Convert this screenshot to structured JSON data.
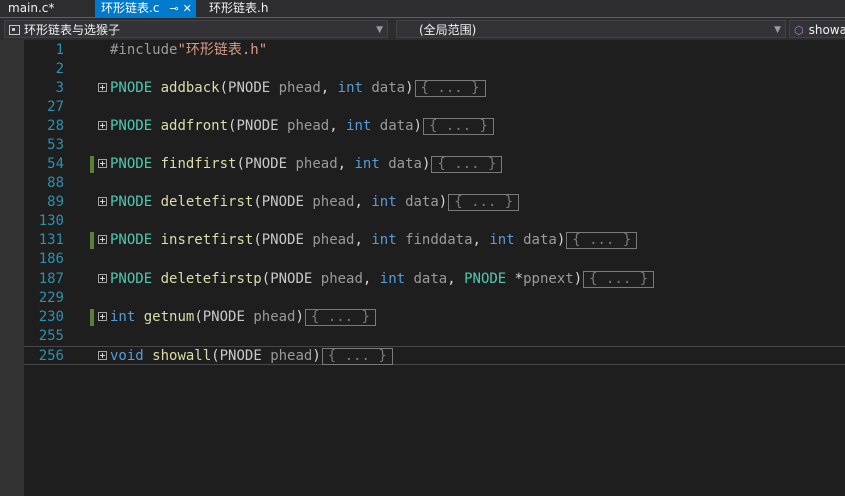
{
  "tabs": [
    {
      "label": "main.c*",
      "active": false
    },
    {
      "label": "环形链表.c",
      "active": true,
      "pin_icon": "pin-icon",
      "close_icon": "close-icon"
    },
    {
      "label": "环形链表.h",
      "active": false
    }
  ],
  "navbar": {
    "project": "环形链表与选猴子",
    "scope": "(全局范围)",
    "member": "showa"
  },
  "colors": {
    "accent": "#007acc",
    "type": "#4ec9b0",
    "function": "#dcdcaa",
    "keyword": "#569cd6",
    "param": "#9a9a9a",
    "line_number": "#2b91af",
    "changed_bar": "#5b7e3a"
  },
  "collapsed_text": "{ ... }",
  "code": {
    "l1": {
      "num": "1",
      "directive": "#include",
      "file": "\"环形链表.h\""
    },
    "l2": {
      "num": "2"
    },
    "l3": {
      "num": "3",
      "ret": "PNODE",
      "name": "addback",
      "open": "(",
      "p1t": "PNODE",
      "p1": " phead",
      "c1": ", ",
      "p2t": "int",
      "p2": " data",
      "close": ")"
    },
    "l27": {
      "num": "27"
    },
    "l28": {
      "num": "28",
      "ret": "PNODE",
      "name": "addfront",
      "open": "(",
      "p1t": "PNODE",
      "p1": " phead",
      "c1": ", ",
      "p2t": "int",
      "p2": " data",
      "close": ")"
    },
    "l53": {
      "num": "53"
    },
    "l54": {
      "num": "54",
      "ret": "PNODE",
      "name": "findfirst",
      "open": "(",
      "p1t": "PNODE",
      "p1": " phead",
      "c1": ", ",
      "p2t": "int",
      "p2": " data",
      "close": ")"
    },
    "l88": {
      "num": "88"
    },
    "l89": {
      "num": "89",
      "ret": "PNODE",
      "name": "deletefirst",
      "open": "(",
      "p1t": "PNODE",
      "p1": " phead",
      "c1": ", ",
      "p2t": "int",
      "p2": " data",
      "close": ")"
    },
    "l130": {
      "num": "130"
    },
    "l131": {
      "num": "131",
      "ret": "PNODE",
      "name": "insretfirst",
      "open": "(",
      "p1t": "PNODE",
      "p1": " phead",
      "c1": ", ",
      "p2t": "int",
      "p2": " finddata",
      "c2": ", ",
      "p3t": "int",
      "p3": " data",
      "close": ")"
    },
    "l186": {
      "num": "186"
    },
    "l187": {
      "num": "187",
      "ret": "PNODE",
      "name": "deletefirstp",
      "open": "(",
      "p1t": "PNODE",
      "p1": " phead",
      "c1": ", ",
      "p2t": "int",
      "p2": " data",
      "c2": ", ",
      "p3t": "PNODE",
      "p3star": " *",
      "p3": "ppnext",
      "close": ")"
    },
    "l229": {
      "num": "229"
    },
    "l230": {
      "num": "230",
      "ret": "int",
      "sp": " ",
      "name": "getnum",
      "open": "(",
      "p1t": "PNODE",
      "p1": " phead",
      "close": ")"
    },
    "l255": {
      "num": "255"
    },
    "l256": {
      "num": "256",
      "ret": "void",
      "sp": " ",
      "name": "showall",
      "open": "(",
      "p1t": "PNODE",
      "p1": " phead",
      "close": ")"
    }
  }
}
